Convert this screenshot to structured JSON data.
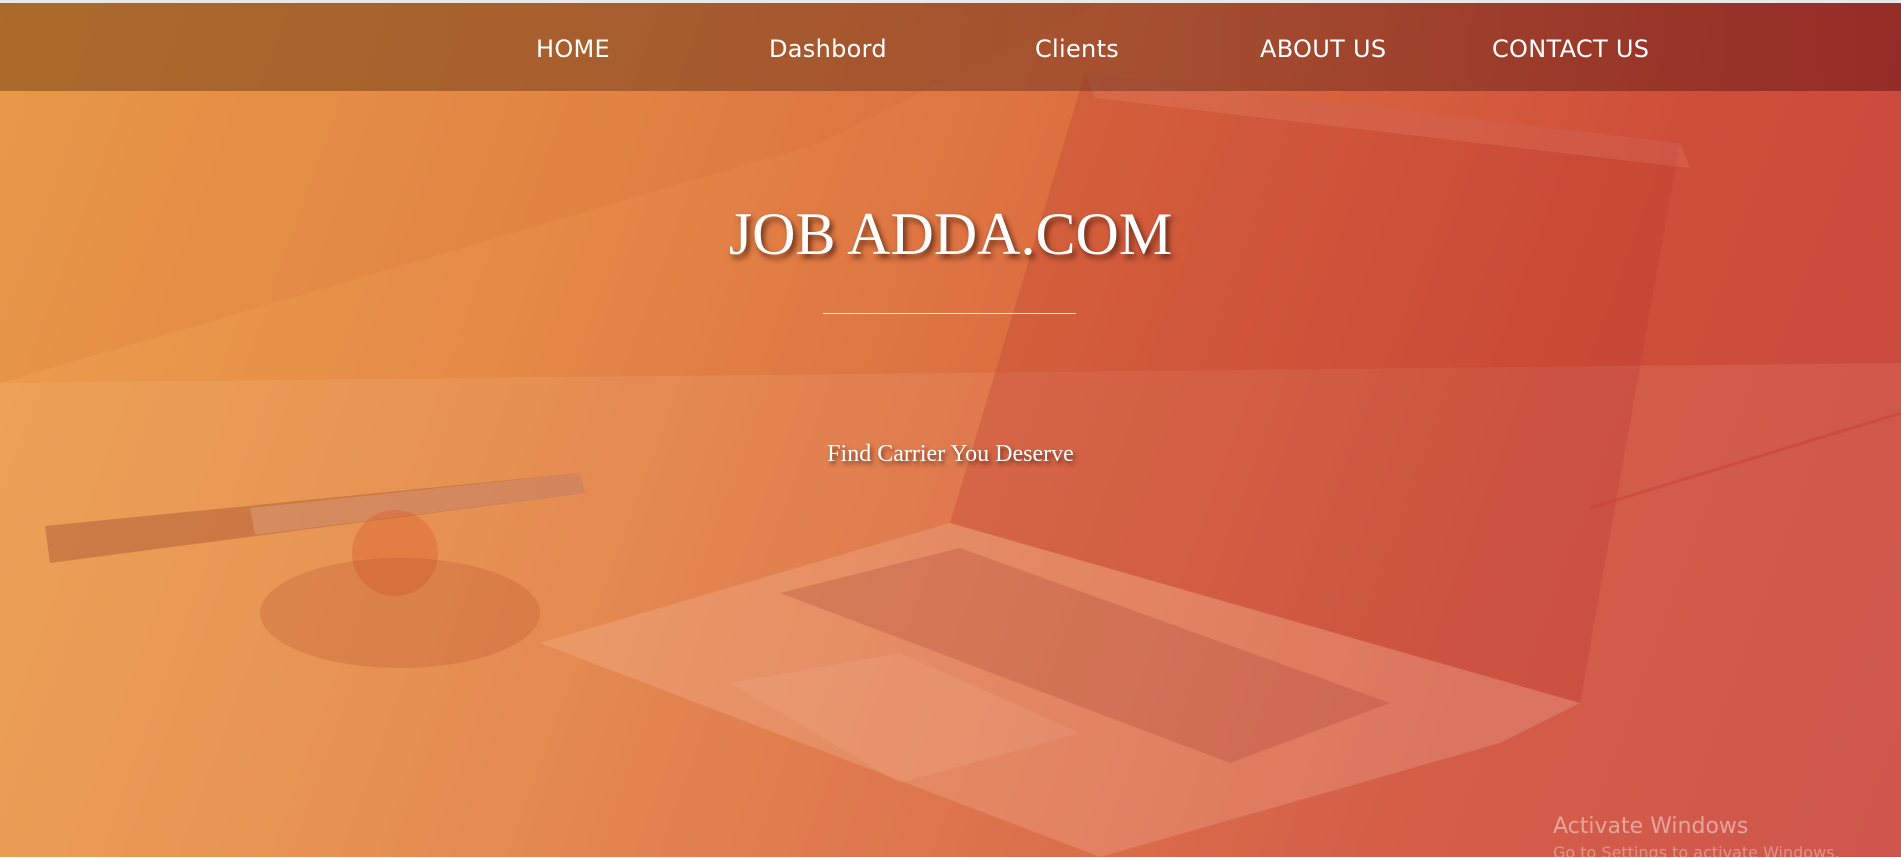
{
  "nav": {
    "items": [
      {
        "label": "HOME"
      },
      {
        "label": "Dashbord"
      },
      {
        "label": "Clients"
      },
      {
        "label": "ABOUT US"
      },
      {
        "label": "CONTACT US"
      }
    ]
  },
  "hero": {
    "title": "JOB ADDA.COM",
    "tagline": "Find Carrier You Deserve",
    "background_image": "laptop-on-desk-photo"
  },
  "os_watermark": {
    "title": "Activate Windows",
    "subtitle": "Go to Settings to activate Windows."
  },
  "colors": {
    "gradient_start": "#eca04c",
    "gradient_end": "#c94740",
    "text": "#ffffff"
  }
}
